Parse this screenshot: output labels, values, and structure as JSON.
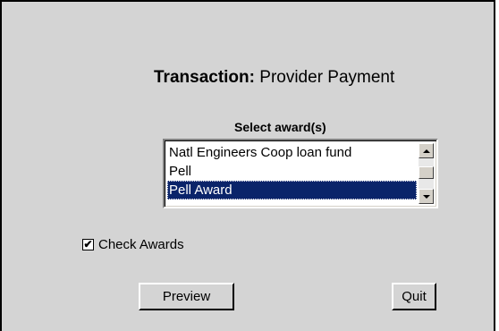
{
  "transaction": {
    "label": "Transaction:",
    "value": "Provider Payment"
  },
  "award_select": {
    "heading": "Select award(s)",
    "options": [
      {
        "label": "Natl Engineers Coop loan fund",
        "selected": false
      },
      {
        "label": "Pell",
        "selected": false
      },
      {
        "label": "Pell Award",
        "selected": true
      }
    ]
  },
  "check_awards": {
    "label": "Check Awards",
    "checked": true,
    "mark": "✔"
  },
  "buttons": {
    "preview_label": "Preview",
    "quit_label": "Quit"
  },
  "colors": {
    "panel_bg": "#d4d4d4",
    "selection_bg": "#0a246a",
    "selection_text": "#ffffff"
  }
}
